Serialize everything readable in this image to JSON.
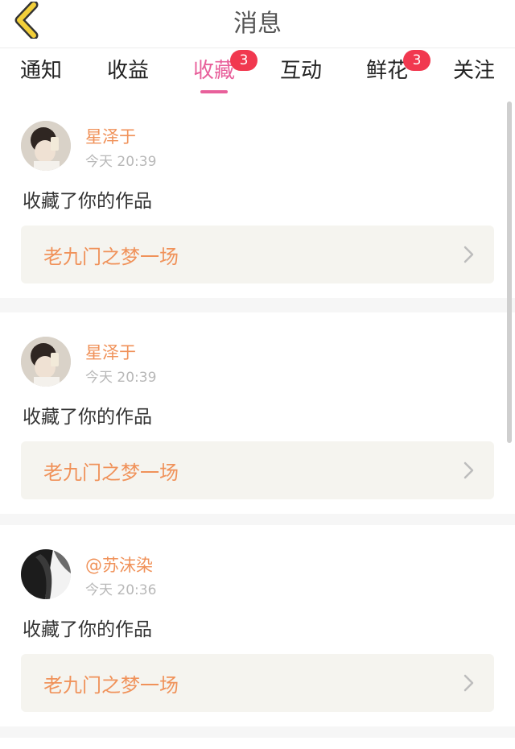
{
  "header": {
    "title": "消息",
    "back_icon": "back-chevron-icon"
  },
  "tabs": [
    {
      "label": "通知",
      "active": false
    },
    {
      "label": "收益",
      "active": false
    },
    {
      "label": "收藏",
      "active": true,
      "badge": "3"
    },
    {
      "label": "互动",
      "active": false
    },
    {
      "label": "鲜花",
      "active": false,
      "badge": "3"
    },
    {
      "label": "关注",
      "active": false
    }
  ],
  "messages": [
    {
      "username": "星泽于",
      "time": "今天 20:39",
      "action": "收藏了你的作品",
      "work_title": "老九门之梦一场"
    },
    {
      "username": "星泽于",
      "time": "今天 20:39",
      "action": "收藏了你的作品",
      "work_title": "老九门之梦一场"
    },
    {
      "username": "@苏沫染",
      "time": "今天 20:36",
      "action": "收藏了你的作品",
      "work_title": "老九门之梦一场"
    }
  ],
  "colors": {
    "accent_pink": "#e8609b",
    "username_orange": "#f0925a",
    "badge_red": "#f1384f",
    "back_yellow": "#f2cf3a"
  }
}
